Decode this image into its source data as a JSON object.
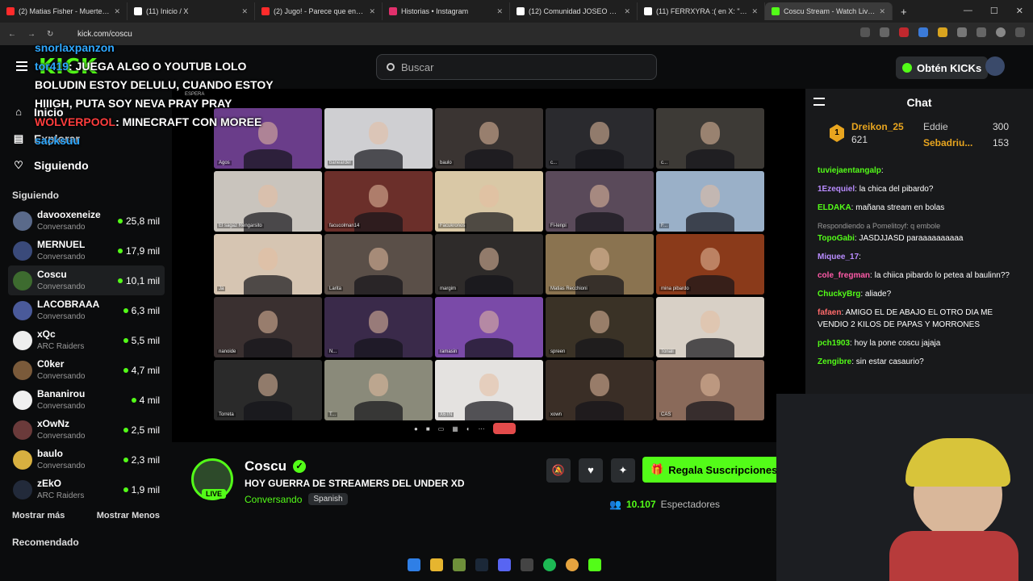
{
  "browser": {
    "tabs": [
      {
        "title": "(2) Matias Fisher - Muerte en",
        "color": "#ff2b2b"
      },
      {
        "title": "(11) Inicio / X",
        "color": "#ffffff"
      },
      {
        "title": "(2) Jugo! - Parece que entreno",
        "color": "#ff2b2b"
      },
      {
        "title": "Historias • Instagram",
        "color": "#e1306c"
      },
      {
        "title": "(12) Comunidad JOSEO EXCLU",
        "color": "#ffffff"
      },
      {
        "title": "(11) FERRXYRA :( en X: \"Hay un",
        "color": "#ffffff"
      },
      {
        "title": "Coscu Stream - Watch Live on",
        "color": "#53fc18",
        "active": true
      }
    ],
    "url": "kick.com/coscu"
  },
  "header": {
    "logo": "KICK",
    "search_placeholder": "Buscar",
    "get_kicks_label": "Obtén KICKs"
  },
  "sidebar": {
    "nav": [
      {
        "label": "Inicio",
        "icon": "home-icon"
      },
      {
        "label": "Explorar",
        "icon": "compass-icon"
      },
      {
        "label": "Siguiendo",
        "icon": "heart-icon"
      }
    ],
    "following_title": "Siguiendo",
    "following": [
      {
        "name": "davooxeneize",
        "category": "Conversando",
        "viewers": "25,8 mil",
        "color": "#5a6a8a"
      },
      {
        "name": "MERNUEL",
        "category": "Conversando",
        "viewers": "17,9 mil",
        "color": "#3a4a7a"
      },
      {
        "name": "Coscu",
        "category": "Conversando",
        "viewers": "10,1 mil",
        "color": "#3d6b2f",
        "selected": true
      },
      {
        "name": "LACOBRAAA",
        "category": "Conversando",
        "viewers": "6,3 mil",
        "color": "#4a5a9a"
      },
      {
        "name": "xQc",
        "category": "ARC Raiders",
        "viewers": "5,5 mil",
        "color": "#eeeeee"
      },
      {
        "name": "C0ker",
        "category": "Conversando",
        "viewers": "4,7 mil",
        "color": "#7a5a3a"
      },
      {
        "name": "Bananirou",
        "category": "Conversando",
        "viewers": "4 mil",
        "color": "#f0f0f0"
      },
      {
        "name": "xOwNz",
        "category": "Conversando",
        "viewers": "2,5 mil",
        "color": "#6a3a3a"
      },
      {
        "name": "baulo",
        "category": "Conversando",
        "viewers": "2,3 mil",
        "color": "#d8b040"
      },
      {
        "name": "zEkO",
        "category": "ARC Raiders",
        "viewers": "1,9 mil",
        "color": "#222a3a"
      }
    ],
    "show_more": "Mostrar más",
    "show_less": "Mostrar Menos",
    "recommended": "Recomendado"
  },
  "overlay_chat": [
    {
      "user": "snorlaxpanzon",
      "text": ""
    },
    {
      "user": "tor419",
      "text": "JUEGA ALGO O YOUTUB LOLO"
    },
    {
      "user": "",
      "text": "BOLUDIN ESTOY DELULU, CUANDO ESTOY HIIIGH, PUTA SOY NEVA PRAY PRAY"
    },
    {
      "user": "WOLVERPOOL",
      "text": "MINECRAFT CON MOREE"
    },
    {
      "user": "sacksuu",
      "text": ""
    }
  ],
  "call": {
    "label": "ESPERA",
    "participants": [
      {
        "name": "Agos",
        "bg": "#6a3d8a"
      },
      {
        "name": "baneardel",
        "bg": "#cfcfd2"
      },
      {
        "name": "baulo",
        "bg": "#3a3432"
      },
      {
        "name": "c...",
        "bg": "#2a2a2e"
      },
      {
        "name": "c...",
        "bg": "#3d3a36"
      },
      {
        "name": "El sagaz Rengarsito",
        "bg": "#c9c4bd"
      },
      {
        "name": "facucolman14",
        "bg": "#6b2f2a"
      },
      {
        "name": "Facukronos",
        "bg": "#d9c8a6"
      },
      {
        "name": "Fi-lenpi",
        "bg": "#5a4a5a"
      },
      {
        "name": "F...",
        "bg": "#9ab0c8"
      },
      {
        "name": "Ja",
        "bg": "#d6c5b2"
      },
      {
        "name": "Larita",
        "bg": "#5a4f48"
      },
      {
        "name": "margim",
        "bg": "#2e2b2a"
      },
      {
        "name": "Matias Recchioni",
        "bg": "#8a7350"
      },
      {
        "name": "mina pibardo",
        "bg": "#8a3a1a"
      },
      {
        "name": "nanoide",
        "bg": "#3a3030"
      },
      {
        "name": "N...",
        "bg": "#3a2a4a"
      },
      {
        "name": "ramasin",
        "bg": "#7a4aa8"
      },
      {
        "name": "spreen",
        "bg": "#3a3226"
      },
      {
        "name": "Tonali",
        "bg": "#d8d0c6"
      },
      {
        "name": "Torreta",
        "bg": "#2a2a2a"
      },
      {
        "name": "T...",
        "bg": "#8a8a7a"
      },
      {
        "name": "X6TN",
        "bg": "#e4e2e0"
      },
      {
        "name": "xown",
        "bg": "#3a2e26"
      },
      {
        "name": "CAS",
        "bg": "#8a6a5a"
      }
    ]
  },
  "channel": {
    "name": "Coscu",
    "live_badge": "LIVE",
    "title": "HOY GUERRA DE STREAMERS DEL UNDER XD",
    "category": "Conversando",
    "language": "Spanish",
    "viewers": "10.107",
    "viewers_label": "Espectadores",
    "subscribe_label": "Regala Suscripciones"
  },
  "chat": {
    "title": "Chat",
    "leaderboard": [
      {
        "rank": "1",
        "name": "Dreikon_25",
        "value": "621"
      },
      {
        "rank": "",
        "name": "Eddie",
        "value": "300"
      },
      {
        "rank": "",
        "name": "Sebadriu...",
        "value": "153"
      }
    ],
    "messages": [
      {
        "user": "tuviejaentangalp",
        "text": "",
        "color": "#53fc18"
      },
      {
        "user": "1Ezequiel",
        "text": "la chica del pibardo?",
        "color": "#b98cff"
      },
      {
        "user": "ELDAKA",
        "text": "mañana stream en bolas",
        "color": "#53fc18"
      },
      {
        "user": "",
        "text": "Respondiendo a Pomelitoyf: q embole",
        "color": "#999999",
        "reply": true
      },
      {
        "user": "TopoGabi",
        "text": "JASDJJASD paraaaaaaaaaa",
        "color": "#53fc18"
      },
      {
        "user": "Miquee_17",
        "text": "",
        "color": "#b98cff"
      },
      {
        "user": "cole_fregman",
        "text": "la chiica pibardo lo petea al baulinn??",
        "color": "#ff5aa8"
      },
      {
        "user": "ChuckyBrg",
        "text": "aliade?",
        "color": "#53fc18"
      },
      {
        "user": "fafaen",
        "text": "AMIGO EL DE ABAJO EL OTRO DIA ME VENDIO 2 KILOS DE PAPAS Y MORRONES",
        "color": "#ff6a6a"
      },
      {
        "user": "pch1903",
        "text": "hoy la pone coscu jajaja",
        "color": "#53fc18"
      },
      {
        "user": "Zengibre",
        "text": "sin estar casaurio?",
        "color": "#53fc18"
      }
    ]
  }
}
